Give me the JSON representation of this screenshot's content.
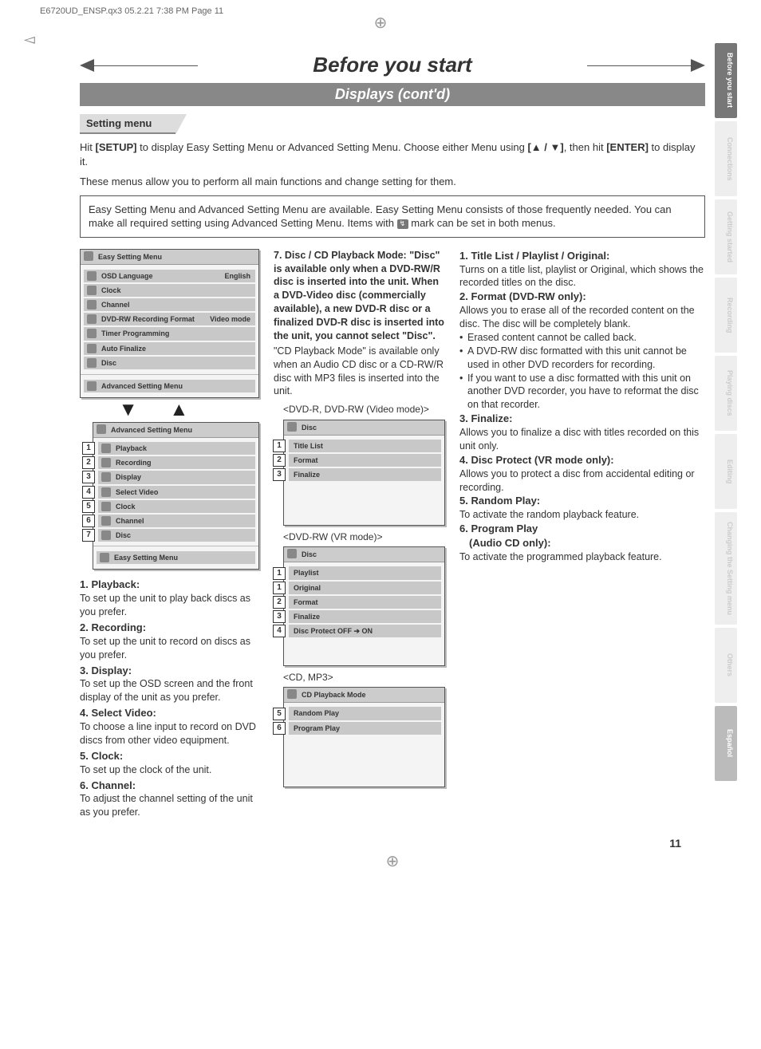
{
  "header_line": "E6720UD_ENSP.qx3  05.2.21 7:38 PM  Page 11",
  "title": "Before you start",
  "subtitle": "Displays (cont'd)",
  "section_label": "Setting menu",
  "intro": {
    "p1a": "Hit ",
    "p1b": "[SETUP]",
    "p1c": " to display Easy Setting Menu or Advanced Setting Menu. Choose either Menu using ",
    "p1d": "[▲ / ▼]",
    "p1e": ", then hit ",
    "p1f": "[ENTER]",
    "p1g": " to display it.",
    "p2": "These menus allow you to perform all main functions and change setting for them."
  },
  "box": {
    "t1": "Easy Setting Menu and Advanced Setting Menu are available. Easy Setting Menu consists of those frequently needed. You can make all required setting using Advanced Setting Menu. Items with ",
    "t2": " mark can be set in both menus."
  },
  "easy_menu": {
    "title": "Easy Setting Menu",
    "rows": [
      {
        "label": "OSD Language",
        "value": "English"
      },
      {
        "label": "Clock",
        "value": ""
      },
      {
        "label": "Channel",
        "value": ""
      },
      {
        "label": "DVD-RW Recording Format",
        "value": "Video mode"
      },
      {
        "label": "Timer Programming",
        "value": ""
      },
      {
        "label": "Auto Finalize",
        "value": ""
      },
      {
        "label": "Disc",
        "value": ""
      }
    ],
    "footer": "Advanced Setting Menu"
  },
  "adv_menu": {
    "title": "Advanced Setting Menu",
    "rows": [
      {
        "n": "1",
        "label": "Playback"
      },
      {
        "n": "2",
        "label": "Recording"
      },
      {
        "n": "3",
        "label": "Display"
      },
      {
        "n": "4",
        "label": "Select Video"
      },
      {
        "n": "5",
        "label": "Clock"
      },
      {
        "n": "6",
        "label": "Channel"
      },
      {
        "n": "7",
        "label": "Disc"
      }
    ],
    "footer": "Easy Setting Menu"
  },
  "col1_desc": [
    {
      "h": "1. Playback:",
      "b": "To set up the unit to play back discs as you prefer."
    },
    {
      "h": "2. Recording:",
      "b": "To set up the unit to record on discs as you prefer."
    },
    {
      "h": "3. Display:",
      "b": "To set up the OSD screen and the front display of the unit as you prefer."
    },
    {
      "h": "4. Select Video:",
      "b": "To choose a line input to record on DVD discs from other video equipment."
    },
    {
      "h": "5. Clock:",
      "b": "To set up the clock of the unit."
    },
    {
      "h": "6. Channel:",
      "b": "To adjust the channel setting of the unit as you prefer."
    }
  ],
  "col2_head": {
    "h": "7. Disc / CD Playback Mode: \"Disc\" is available only when a DVD-RW/R disc is inserted into the unit.  When a DVD-Video disc (commercially available), a new DVD-R disc or a finalized DVD-R disc is inserted into the unit, you cannot select \"Disc\".",
    "b": "\"CD Playback Mode\" is available only when an Audio CD disc or a CD-RW/R disc with MP3 files is inserted into the unit."
  },
  "disc_video": {
    "caption": "<DVD-R, DVD-RW (Video mode)>",
    "title": "Disc",
    "rows": [
      {
        "n": "1",
        "label": "Title List"
      },
      {
        "n": "2",
        "label": "Format"
      },
      {
        "n": "3",
        "label": "Finalize"
      }
    ]
  },
  "disc_vr": {
    "caption": "<DVD-RW (VR mode)>",
    "title": "Disc",
    "rows": [
      {
        "n": "1",
        "label": "Playlist"
      },
      {
        "n": "1",
        "label": "Original"
      },
      {
        "n": "2",
        "label": "Format"
      },
      {
        "n": "3",
        "label": "Finalize"
      },
      {
        "n": "4",
        "label": "Disc Protect OFF ➔ ON"
      }
    ]
  },
  "disc_cd": {
    "caption": "<CD, MP3>",
    "title": "CD Playback Mode",
    "rows": [
      {
        "n": "5",
        "label": "Random Play"
      },
      {
        "n": "6",
        "label": "Program Play"
      }
    ]
  },
  "col3": [
    {
      "h": "1. Title List / Playlist / Original:",
      "b": "Turns on a title list, playlist or Original, which shows the recorded titles on the disc."
    },
    {
      "h": "2. Format (DVD-RW only):",
      "b": "Allows you to erase all of the recorded content on the disc. The disc will be completely blank.",
      "bul": [
        "Erased content cannot be called back.",
        "A DVD-RW disc formatted with this unit cannot be used in other DVD recorders for recording.",
        "If you want to use a disc formatted with this unit on another DVD recorder, you have to reformat the disc on that recorder."
      ]
    },
    {
      "h": "3. Finalize:",
      "b": "Allows you to finalize a disc with titles recorded on this unit only."
    },
    {
      "h": "4. Disc Protect (VR mode only):",
      "b": "Allows you to protect a disc from accidental editing or recording.",
      "indent": true
    },
    {
      "h": "5. Random Play:",
      "b": "To activate the random playback feature."
    },
    {
      "h": "6. Program Play",
      "h2": "(Audio CD only):",
      "b": "To activate the programmed playback feature.",
      "indent": true
    }
  ],
  "side_tabs": [
    {
      "label": "Before you start",
      "active": true
    },
    {
      "label": "Connections"
    },
    {
      "label": "Getting started"
    },
    {
      "label": "Recording"
    },
    {
      "label": "Playing discs"
    },
    {
      "label": "Editing"
    },
    {
      "label": "Changing the Setting menu"
    },
    {
      "label": "Others"
    },
    {
      "label": "Español",
      "gray": true
    }
  ],
  "page_number": "11"
}
